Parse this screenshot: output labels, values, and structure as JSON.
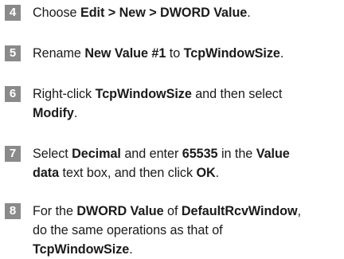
{
  "steps": [
    {
      "number": "4",
      "segments": [
        {
          "text": "Choose ",
          "bold": false
        },
        {
          "text": "Edit > New > DWORD Value",
          "bold": true
        },
        {
          "text": ".",
          "bold": false
        }
      ]
    },
    {
      "number": "5",
      "segments": [
        {
          "text": "Rename ",
          "bold": false
        },
        {
          "text": "New Value #1",
          "bold": true
        },
        {
          "text": " to ",
          "bold": false
        },
        {
          "text": "TcpWindowSize",
          "bold": true
        },
        {
          "text": ".",
          "bold": false
        }
      ]
    },
    {
      "number": "6",
      "segments": [
        {
          "text": "Right-click ",
          "bold": false
        },
        {
          "text": "TcpWindowSize",
          "bold": true
        },
        {
          "text": " and then select",
          "bold": false
        },
        {
          "text": "\n",
          "bold": false
        },
        {
          "text": "Modify",
          "bold": true
        },
        {
          "text": ".",
          "bold": false
        }
      ]
    },
    {
      "number": "7",
      "segments": [
        {
          "text": "Select ",
          "bold": false
        },
        {
          "text": "Decimal",
          "bold": true
        },
        {
          "text": " and enter ",
          "bold": false
        },
        {
          "text": "65535",
          "bold": true
        },
        {
          "text": " in the ",
          "bold": false
        },
        {
          "text": "Value",
          "bold": true
        },
        {
          "text": "\n",
          "bold": false
        },
        {
          "text": "data",
          "bold": true
        },
        {
          "text": " text box, and then click ",
          "bold": false
        },
        {
          "text": "OK",
          "bold": true
        },
        {
          "text": ".",
          "bold": false
        }
      ]
    },
    {
      "number": "8",
      "segments": [
        {
          "text": "For the ",
          "bold": false
        },
        {
          "text": "DWORD Value",
          "bold": true
        },
        {
          "text": " of ",
          "bold": false
        },
        {
          "text": "DefaultRcvWindow",
          "bold": true
        },
        {
          "text": ",",
          "bold": false
        },
        {
          "text": "\n",
          "bold": false
        },
        {
          "text": "do the same operations as that of",
          "bold": false
        },
        {
          "text": "\n",
          "bold": false
        },
        {
          "text": "TcpWindowSize",
          "bold": true
        },
        {
          "text": ".",
          "bold": false
        }
      ]
    }
  ]
}
